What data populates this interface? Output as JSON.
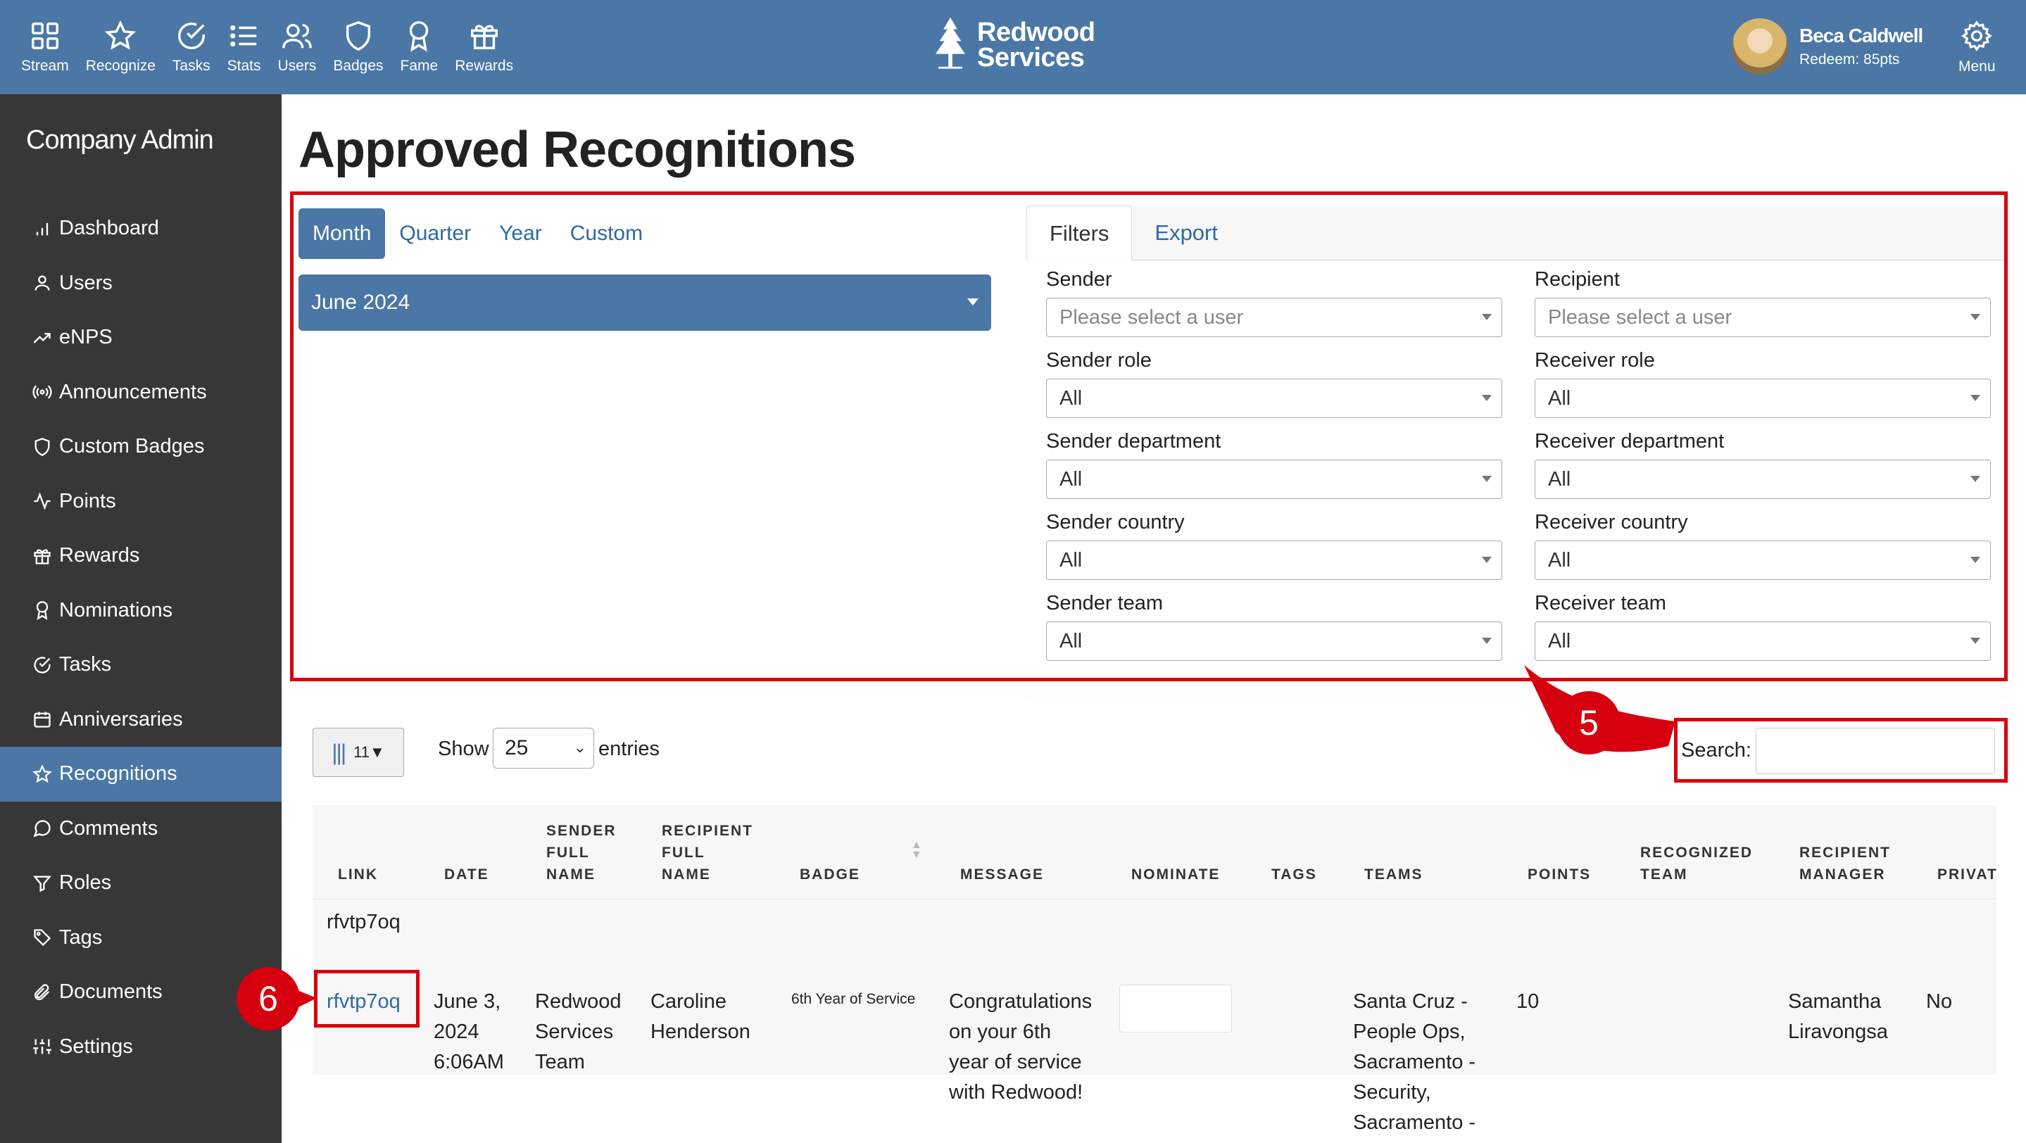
{
  "topbar": {
    "nav": [
      {
        "label": "Stream",
        "icon": "grid-icon"
      },
      {
        "label": "Recognize",
        "icon": "star-icon"
      },
      {
        "label": "Tasks",
        "icon": "check-circle-icon"
      },
      {
        "label": "Stats",
        "icon": "list-icon"
      },
      {
        "label": "Users",
        "icon": "users-icon"
      },
      {
        "label": "Badges",
        "icon": "shield-icon"
      },
      {
        "label": "Fame",
        "icon": "award-icon"
      },
      {
        "label": "Rewards",
        "icon": "gift-icon"
      }
    ],
    "brand_line1": "Redwood",
    "brand_line2": "Services",
    "user_name": "Beca Caldwell",
    "user_points": "Redeem: 85pts",
    "menu_label": "Menu",
    "color": "#4a77a5"
  },
  "sidebar": {
    "title": "Company Admin",
    "items": [
      {
        "label": "Dashboard",
        "icon": "bar-chart-icon"
      },
      {
        "label": "Users",
        "icon": "user-icon"
      },
      {
        "label": "eNPS",
        "icon": "trend-icon"
      },
      {
        "label": "Announcements",
        "icon": "broadcast-icon"
      },
      {
        "label": "Custom Badges",
        "icon": "shield-icon"
      },
      {
        "label": "Points",
        "icon": "activity-icon"
      },
      {
        "label": "Rewards",
        "icon": "gift-icon"
      },
      {
        "label": "Nominations",
        "icon": "award-icon"
      },
      {
        "label": "Tasks",
        "icon": "check-circle-icon"
      },
      {
        "label": "Anniversaries",
        "icon": "calendar-icon"
      },
      {
        "label": "Recognitions",
        "icon": "star-icon",
        "active": true
      },
      {
        "label": "Comments",
        "icon": "comment-icon"
      },
      {
        "label": "Roles",
        "icon": "filter-icon"
      },
      {
        "label": "Tags",
        "icon": "tag-icon"
      },
      {
        "label": "Documents",
        "icon": "paperclip-icon"
      },
      {
        "label": "Settings",
        "icon": "sliders-icon"
      }
    ]
  },
  "main": {
    "title": "Approved Recognitions",
    "period_tabs": [
      "Month",
      "Quarter",
      "Year",
      "Custom"
    ],
    "active_period": "Month",
    "month_value": "June 2024",
    "filter_tabs": [
      "Filters",
      "Export"
    ],
    "filters": {
      "sender_label": "Sender",
      "sender_value": "Please select a user",
      "recipient_label": "Recipient",
      "recipient_value": "Please select a user",
      "sender_role_label": "Sender role",
      "sender_role_value": "All",
      "receiver_role_label": "Receiver role",
      "receiver_role_value": "All",
      "sender_department_label": "Sender department",
      "sender_department_value": "All",
      "receiver_department_label": "Receiver department",
      "receiver_department_value": "All",
      "sender_country_label": "Sender country",
      "sender_country_value": "All",
      "receiver_country_label": "Receiver country",
      "receiver_country_value": "All",
      "sender_team_label": "Sender team",
      "sender_team_value": "All",
      "receiver_team_label": "Receiver team",
      "receiver_team_value": "All"
    },
    "columns_button_count": "11▼",
    "show_label": "Show",
    "show_value": "25",
    "entries_label": "entries",
    "search_label": "Search:",
    "search_value": ""
  },
  "table": {
    "headers": {
      "link": "LINK",
      "date": "DATE",
      "sender_full_name": "SENDER\nFULL\nNAME",
      "recipient_full_name": "RECIPIENT\nFULL\nNAME",
      "badge": "BADGE",
      "message": "MESSAGE",
      "nominate": "NOMINATE",
      "tags": "TAGS",
      "teams": "TEAMS",
      "points": "POINTS",
      "recognized_team": "RECOGNIZED\nTEAM",
      "recipient_manager": "RECIPIENT\nMANAGER",
      "private": "PRIVAT"
    },
    "filter_value": "rfvtp7oq",
    "row": {
      "link": "rfvtp7oq",
      "date": "June 3,\n2024\n6:06AM",
      "sender": "Redwood\nServices\nTeam",
      "recipient": "Caroline\nHenderson",
      "badge": "6th Year of Service",
      "message": "Congratulations\non your 6th\nyear of service\nwith Redwood!",
      "teams": "Santa Cruz -\nPeople Ops,\nSacramento -\nSecurity,\nSacramento -",
      "points": "10",
      "manager": "Samantha\nLiravongsa",
      "private": "No"
    }
  },
  "callouts": {
    "step5": "5",
    "step6": "6",
    "color": "#d7000f"
  }
}
